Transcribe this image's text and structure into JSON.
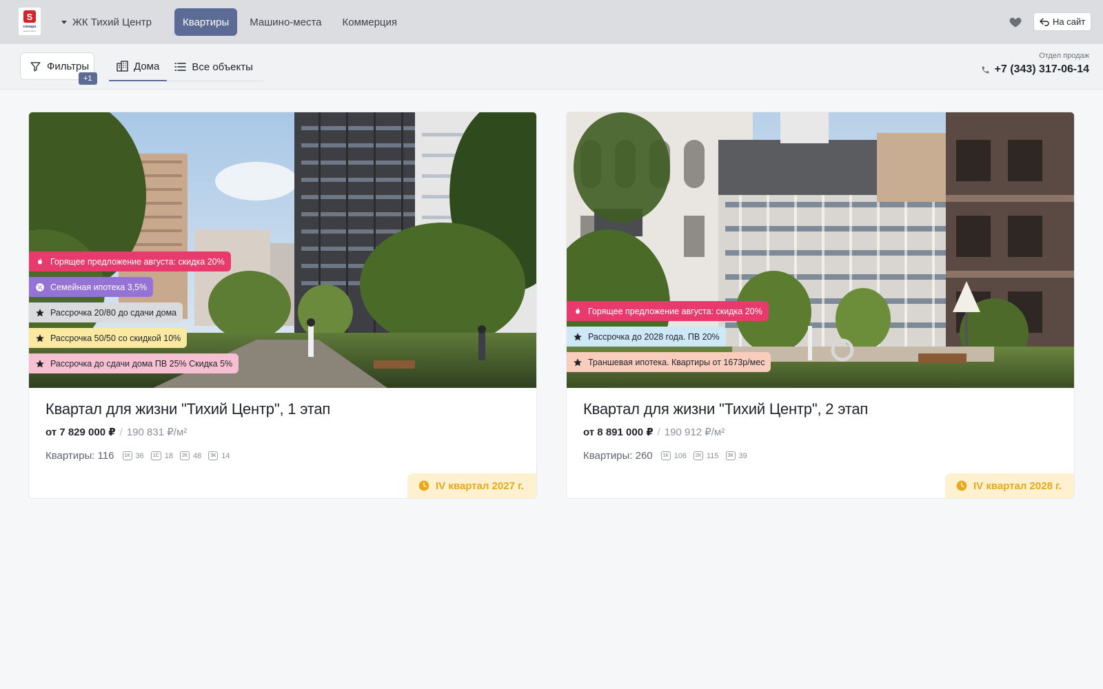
{
  "header": {
    "logo_text": "синара",
    "logo_sub": "девелопмент",
    "project_name": "ЖК Тихий Центр",
    "tabs": [
      {
        "label": "Квартиры",
        "active": true
      },
      {
        "label": "Машино-места",
        "active": false
      },
      {
        "label": "Коммерция",
        "active": false
      }
    ],
    "to_site_label": "На сайт"
  },
  "toolbar": {
    "filters_label": "Фильтры",
    "filters_badge": "+1",
    "view_tabs": [
      {
        "label": "Дома",
        "icon": "building-icon",
        "active": true
      },
      {
        "label": "Все объекты",
        "icon": "list-icon",
        "active": false
      }
    ],
    "sales_label": "Отдел продаж",
    "sales_phone": "+7 (343) 317-06-14"
  },
  "colors": {
    "accent": "#5b6b95",
    "tag_hot": "#e83a6d",
    "tag_family": "#9472d6",
    "tag_gray": "#dadbdd",
    "tag_yellow": "#fbe9a2",
    "tag_pink": "#f7c0d2",
    "tag_blue": "#cfe8f8",
    "tag_peach": "#f8cdbd",
    "deadline_bg": "#fdf1cf",
    "deadline_text": "#e8a81e"
  },
  "cards": [
    {
      "title": "Квартал для жизни \"Тихий Центр\", 1 этап",
      "price": "от 7 829 000 ₽",
      "price_per_m2": "190 831 ₽/м²",
      "apartments_total": "Квартиры: 116",
      "apartment_types": [
        {
          "type": "1К",
          "count": "36"
        },
        {
          "type": "1С",
          "count": "18"
        },
        {
          "type": "2К",
          "count": "48"
        },
        {
          "type": "3К",
          "count": "14"
        }
      ],
      "deadline": "IV квартал 2027 г.",
      "tags": [
        {
          "label": "Горящее предложение августа: скидка 20%",
          "icon": "fire-icon",
          "style": "hot"
        },
        {
          "label": "Семейная ипотека 3,5%",
          "icon": "percent-icon",
          "style": "family"
        },
        {
          "label": "Рассрочка 20/80 до сдачи дома",
          "icon": "star-icon",
          "style": "gray"
        },
        {
          "label": "Рассрочка 50/50 со скидкой 10%",
          "icon": "star-icon",
          "style": "yellow"
        },
        {
          "label": "Рассрочка до сдачи дома ПВ 25% Скидка 5%",
          "icon": "star-icon",
          "style": "pink"
        }
      ]
    },
    {
      "title": "Квартал для жизни \"Тихий Центр\", 2 этап",
      "price": "от 8 891 000 ₽",
      "price_per_m2": "190 912 ₽/м²",
      "apartments_total": "Квартиры: 260",
      "apartment_types": [
        {
          "type": "1К",
          "count": "106"
        },
        {
          "type": "2К",
          "count": "115"
        },
        {
          "type": "3К",
          "count": "39"
        }
      ],
      "deadline": "IV квартал 2028 г.",
      "tags": [
        {
          "label": "Горящее предложение августа: скидка 20%",
          "icon": "fire-icon",
          "style": "hot"
        },
        {
          "label": "Рассрочка до 2028 года. ПВ 20%",
          "icon": "star-icon",
          "style": "blue"
        },
        {
          "label": "Траншевая ипотека. Квартиры от 1673р/мес",
          "icon": "star-icon",
          "style": "peach"
        }
      ]
    }
  ]
}
